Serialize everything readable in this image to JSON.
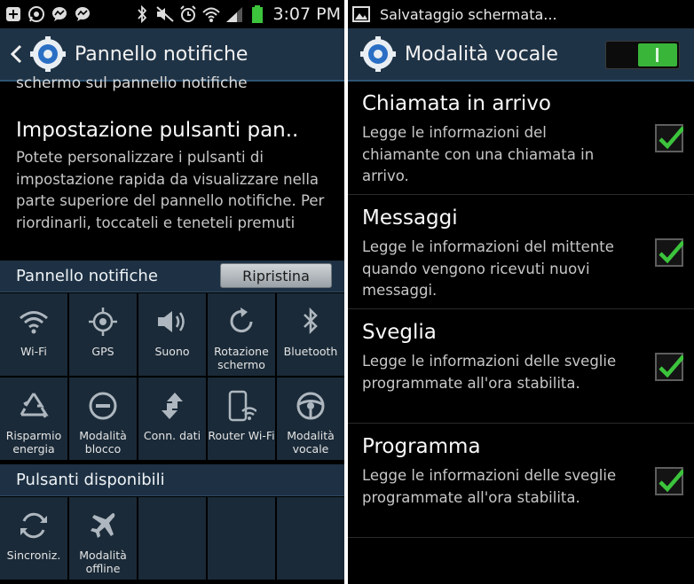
{
  "left": {
    "statusbar": {
      "icons": [
        "plus-icon",
        "whatsapp-icon",
        "messenger-icon",
        "messenger-icon",
        "bluetooth-icon",
        "mute-icon",
        "alarm-icon",
        "wifi-icon",
        "signal-icon",
        "battery-icon"
      ],
      "time": "3:07 PM"
    },
    "actionbar": {
      "title": "Pannello notifiche"
    },
    "cut_text": "schermo sul pannello notifiche",
    "setting": {
      "title": "Impostazione pulsanti pan..",
      "description": "Potete personalizzare i pulsanti di impostazione rapida da visualizzare nella parte superiore del pannello notifiche. Per riordinarli, toccateli e teneteli premuti"
    },
    "panel_section": {
      "label": "Pannello notifiche",
      "reset_label": "Ripristina"
    },
    "panel_tiles": [
      {
        "label": "Wi-Fi",
        "icon": "wifi-icon"
      },
      {
        "label": "GPS",
        "icon": "gps-icon"
      },
      {
        "label": "Suono",
        "icon": "sound-icon"
      },
      {
        "label": "Rotazione schermo",
        "icon": "rotation-icon"
      },
      {
        "label": "Bluetooth",
        "icon": "bluetooth-icon"
      },
      {
        "label": "Risparmio energia",
        "icon": "recycle-icon"
      },
      {
        "label": "Modalità blocco",
        "icon": "block-icon"
      },
      {
        "label": "Conn. dati",
        "icon": "data-arrows-icon"
      },
      {
        "label": "Router Wi-Fi",
        "icon": "hotspot-icon"
      },
      {
        "label": "Modalità vocale",
        "icon": "steering-wheel-icon"
      }
    ],
    "available_section": {
      "label": "Pulsanti disponibili"
    },
    "available_tiles": [
      {
        "label": "Sincroniz.",
        "icon": "sync-icon"
      },
      {
        "label": "Modalità offline",
        "icon": "airplane-icon"
      }
    ]
  },
  "right": {
    "statusbar": {
      "notification_text": "Salvataggio schermata..."
    },
    "actionbar": {
      "title": "Modalità vocale",
      "toggle_on": true
    },
    "options": [
      {
        "title": "Chiamata in arrivo",
        "description": "Legge le informazioni del chiamante con una chiamata in arrivo.",
        "checked": true
      },
      {
        "title": "Messaggi",
        "description": "Legge le informazioni del mittente quando vengono ricevuti nuovi messaggi.",
        "checked": true
      },
      {
        "title": "Sveglia",
        "description": "Legge le informazioni delle sveglie programmate all'ora stabilita.",
        "checked": true
      },
      {
        "title": "Programma",
        "description": "Legge le informazioni delle sveglie programmate all'ora stabilita.",
        "checked": true
      }
    ]
  },
  "colors": {
    "actionbar": "#1f3346",
    "tile": "#1a2a38",
    "check_green": "#3cc43c",
    "switch_on": "#39b53a"
  }
}
